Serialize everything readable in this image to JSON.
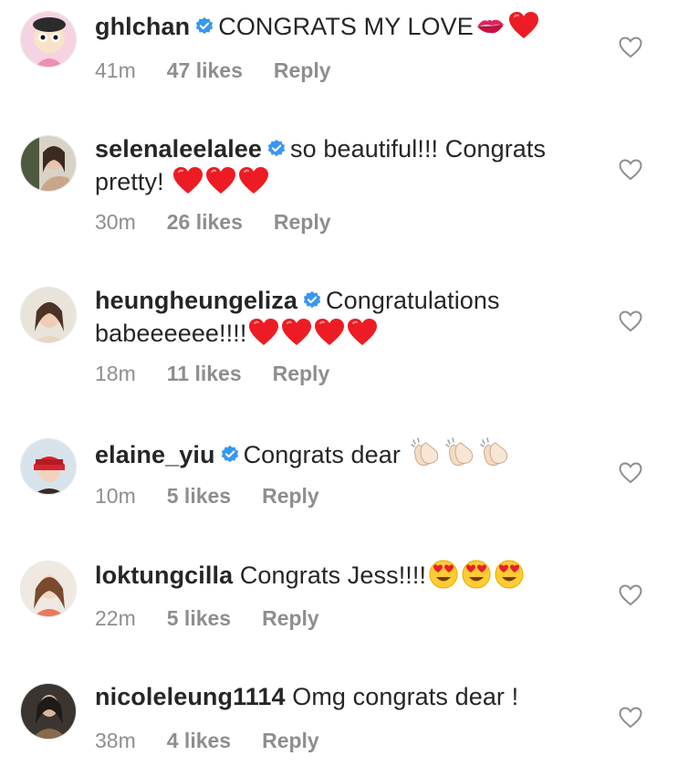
{
  "comments": [
    {
      "username": "ghlchan",
      "verified": true,
      "text": "CONGRATS MY LOVE",
      "emojis": [
        "kiss-mark",
        "red-heart"
      ],
      "time": "41m",
      "likes": "47 likes",
      "reply": "Reply"
    },
    {
      "username": "selenaleelalee",
      "verified": true,
      "text": "so beautiful!!! Congrats pretty!",
      "emojis": [
        "red-heart",
        "red-heart",
        "red-heart"
      ],
      "time": "30m",
      "likes": "26 likes",
      "reply": "Reply"
    },
    {
      "username": "heungheungeliza",
      "verified": true,
      "text": "Congratulations babeeeeee!!!!",
      "emojis": [
        "red-heart",
        "red-heart",
        "red-heart",
        "red-heart"
      ],
      "time": "18m",
      "likes": "11 likes",
      "reply": "Reply"
    },
    {
      "username": "elaine_yiu",
      "verified": true,
      "text": "Congrats dear",
      "emojis": [
        "clapping-hands",
        "clapping-hands",
        "clapping-hands"
      ],
      "time": "10m",
      "likes": "5 likes",
      "reply": "Reply"
    },
    {
      "username": "loktungcilla",
      "verified": false,
      "text": "Congrats Jess!!!!",
      "emojis": [
        "heart-eyes",
        "heart-eyes",
        "heart-eyes"
      ],
      "time": "22m",
      "likes": "5 likes",
      "reply": "Reply"
    },
    {
      "username": "nicoleleung1114",
      "verified": false,
      "text": "Omg congrats dear !",
      "emojis": [],
      "time": "38m",
      "likes": "4 likes",
      "reply": "Reply"
    }
  ],
  "colors": {
    "text": "#262626",
    "meta": "#8e8e8e",
    "verified": "#3897f0",
    "heart": "#ed1c24"
  }
}
